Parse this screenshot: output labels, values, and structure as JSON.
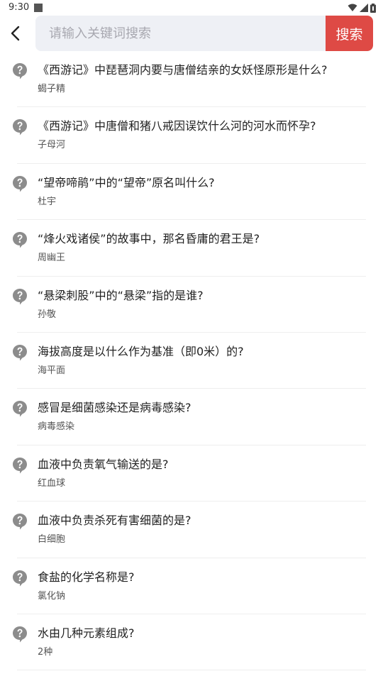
{
  "status_bar": {
    "time": "9:30",
    "icons": [
      "notification-square-icon",
      "wifi-icon",
      "signal-icon",
      "battery-icon"
    ]
  },
  "search": {
    "placeholder": "请输入关键词搜索",
    "value": "",
    "button_label": "搜索",
    "button_color": "#de4a45"
  },
  "results": [
    {
      "question": "《西游记》中琵琶洞内要与唐僧结亲的女妖怪原形是什么?",
      "answer": "蝎子精"
    },
    {
      "question": "《西游记》中唐僧和猪八戒因误饮什么河的河水而怀孕?",
      "answer": "子母河"
    },
    {
      "question": "“望帝啼鹃”中的“望帝”原名叫什么?",
      "answer": "杜宇"
    },
    {
      "question": "“烽火戏诸侯”的故事中，那名昏庸的君王是?",
      "answer": "周幽王"
    },
    {
      "question": "“悬梁刺股”中的“悬梁”指的是谁?",
      "answer": "孙敬"
    },
    {
      "question": "海拔高度是以什么作为基准（即0米）的?",
      "answer": "海平面"
    },
    {
      "question": "感冒是细菌感染还是病毒感染?",
      "answer": "病毒感染"
    },
    {
      "question": "血液中负责氧气输送的是?",
      "answer": "红血球"
    },
    {
      "question": "血液中负责杀死有害细菌的是?",
      "answer": "白细胞"
    },
    {
      "question": "食盐的化学名称是?",
      "answer": "氯化钠"
    },
    {
      "question": "水由几种元素组成?",
      "answer": "2种"
    }
  ]
}
